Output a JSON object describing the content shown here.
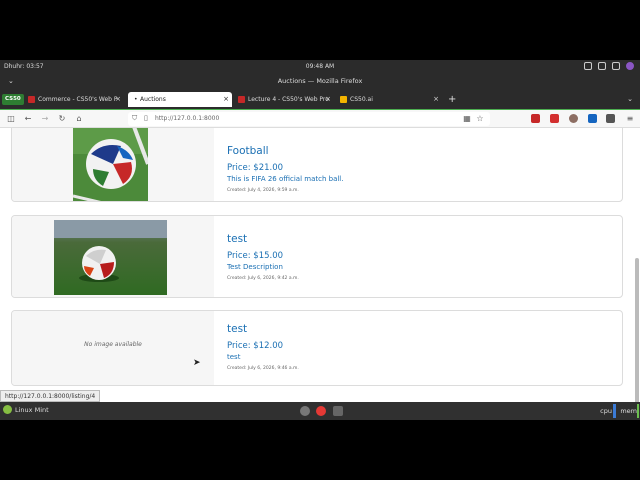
{
  "system_panel": {
    "left_text": "Dhuhr: 03:57",
    "clock": "09:48 AM"
  },
  "window": {
    "title": "Auctions — Mozilla Firefox"
  },
  "tabs": [
    {
      "label": "Commerce - CS50's Web P",
      "active": false,
      "favicon_color": "#c62828"
    },
    {
      "label": "Auctions",
      "active": true,
      "favicon_color": "#9e9e9e"
    },
    {
      "label": "Lecture 4 - CS50's Web Pro",
      "active": false,
      "favicon_color": "#c62828"
    },
    {
      "label": "CS50.ai",
      "active": false,
      "favicon_color": "#f4b400"
    }
  ],
  "cs50_badge": "CS50",
  "address_bar": {
    "url": "http://127.0.0.1:8000"
  },
  "icons": {
    "close": "close-icon",
    "back": "arrow-left-icon",
    "forward": "arrow-right-icon",
    "reload": "reload-icon",
    "home": "home-icon",
    "shield": "shield-icon",
    "page": "page-icon",
    "new_tab": "plus-icon",
    "bookmark": "star-icon"
  },
  "listings": [
    {
      "title": "Football",
      "price": "Price: $21.00",
      "description": "This is FIFA 26 official match ball.",
      "created": "Created: July 4, 2026, 9:59 a.m.",
      "has_image": true
    },
    {
      "title": "test",
      "price": "Price: $15.00",
      "description": "Test Description",
      "created": "Created: July 6, 2026, 9:42 a.m.",
      "has_image": true
    },
    {
      "title": "test",
      "price": "Price: $12.00",
      "description": "test",
      "created": "Created: July 6, 2026, 9:46 a.m.",
      "has_image": false,
      "no_image_text": "No image available"
    }
  ],
  "status_url": "http://127.0.0.1:8000/listing/4",
  "taskbar": {
    "menu_label": "Linux Mint",
    "cpu_label": "cpu",
    "mem_label": "mem"
  },
  "colors": {
    "link_blue": "#1a6fb3",
    "accent_green": "#4caf50",
    "badge_green": "#2e7d32"
  }
}
